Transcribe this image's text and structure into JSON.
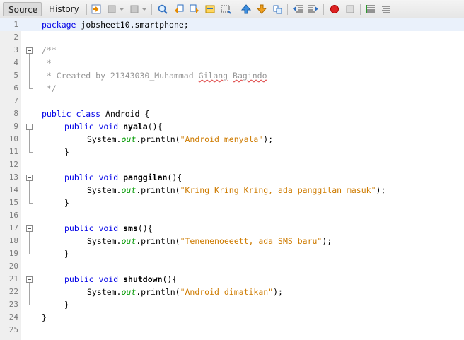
{
  "tabs": {
    "source": "Source",
    "history": "History"
  },
  "toolbar_icons": [
    "last-edit-icon",
    "back-icon",
    "forward-icon",
    "find-icon",
    "find-previous-icon",
    "find-next-icon",
    "find-selection-icon",
    "toggle-highlight-icon",
    "previous-bookmark-icon",
    "next-bookmark-icon",
    "toggle-bookmark-icon",
    "shift-left-icon",
    "shift-right-icon",
    "record-macro-icon",
    "stop-macro-icon",
    "comment-icon",
    "uncomment-icon"
  ],
  "editor": {
    "line_numbers": [
      "1",
      "2",
      "3",
      "4",
      "5",
      "6",
      "7",
      "8",
      "9",
      "10",
      "11",
      "12",
      "13",
      "14",
      "15",
      "16",
      "17",
      "18",
      "19",
      "20",
      "21",
      "22",
      "23",
      "24",
      "25"
    ],
    "code": {
      "l1_kw": "package",
      "l1_rest": " jobsheet10.smartphone;",
      "l3": "/**",
      "l4": " *",
      "l5_pre": " * Created by 21343030_Muhammad ",
      "l5_w1": "Gilang",
      "l5_sp": " ",
      "l5_w2": "Bagindo",
      "l6": " */",
      "l8_kw": "public class",
      "l8_rest": " Android {",
      "kw_pv": "public void",
      "m1": "nyala",
      "m2": "panggilan",
      "m3": "sms",
      "m4": "shutdown",
      "paren": "(){",
      "sys": "System.",
      "out": "out",
      "println": ".println(",
      "s1": "\"Android menyala\"",
      "s2": "\"Kring Kring Kring, ada panggilan masuk\"",
      "s3": "\"Tenenenoeeett, ada SMS baru\"",
      "s4": "\"Android dimatikan\"",
      "end": ");",
      "close": "}"
    }
  },
  "colors": {
    "keyword": "#0000e6",
    "comment": "#969696",
    "string": "#ce7b00",
    "field": "#009900"
  }
}
